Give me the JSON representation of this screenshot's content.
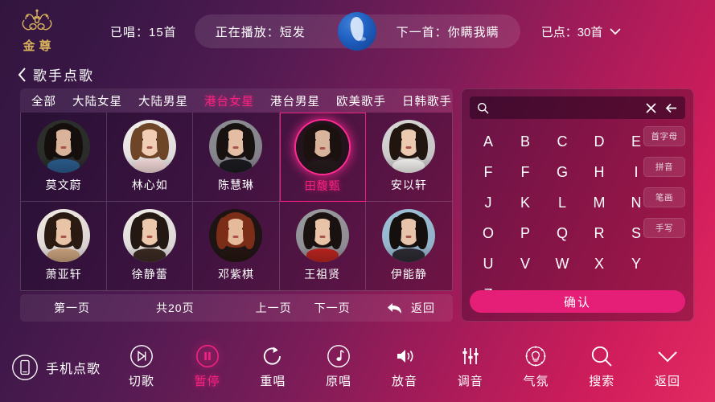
{
  "header": {
    "logo_text": "金尊",
    "logo_icon": "crown-icon",
    "sung_count": "已唱：15首",
    "now_playing": "正在播放：短发",
    "next_song": "下一首：你瞒我瞒",
    "globe_icon": "globe-icon",
    "ordered_count": "已点：30首",
    "ordered_chevron_icon": "chevron-down-icon"
  },
  "breadcrumb": {
    "back_icon": "chevron-left-icon",
    "title": "歌手点歌"
  },
  "tabs": [
    {
      "label": "全部",
      "active": false
    },
    {
      "label": "大陆女星",
      "active": false
    },
    {
      "label": "大陆男星",
      "active": false
    },
    {
      "label": "港台女星",
      "active": true
    },
    {
      "label": "港台男星",
      "active": false
    },
    {
      "label": "欧美歌手",
      "active": false
    },
    {
      "label": "日韩歌手",
      "active": false
    }
  ],
  "artists": [
    {
      "name": "莫文蔚",
      "selected": false,
      "bg": "#2b2f2a",
      "hair": "#140f0c",
      "skin": "#d9b39a",
      "top": "#2a5b8c"
    },
    {
      "name": "林心如",
      "selected": false,
      "bg": "#f3f1ee",
      "hair": "#6e4526",
      "skin": "#f0cdb4",
      "top": "#f2d7d7"
    },
    {
      "name": "陈慧琳",
      "selected": false,
      "bg": "#8d8d93",
      "hair": "#17120f",
      "skin": "#e3bda4",
      "top": "#1b1b20"
    },
    {
      "name": "田馥甄",
      "selected": true,
      "bg": "#23131b",
      "hair": "#1b1210",
      "skin": "#d8b49c",
      "top": "#241a1c"
    },
    {
      "name": "安以轩",
      "selected": false,
      "bg": "#d8d7d6",
      "hair": "#20160f",
      "skin": "#eccab0",
      "top": "#f2f0ee"
    },
    {
      "name": "萧亚轩",
      "selected": false,
      "bg": "#efe9e3",
      "hair": "#2a1a12",
      "skin": "#e9c3a6",
      "top": "#c9a27e"
    },
    {
      "name": "徐静蕾",
      "selected": false,
      "bg": "#efece8",
      "hair": "#241812",
      "skin": "#ecc8ad",
      "top": "#3a2a22"
    },
    {
      "name": "邓紫棋",
      "selected": false,
      "bg": "#1d1412",
      "hair": "#7c2d18",
      "skin": "#e5bb9c",
      "top": "#241612"
    },
    {
      "name": "王祖贤",
      "selected": false,
      "bg": "#9a9a9e",
      "hair": "#1a1210",
      "skin": "#e8c3a8",
      "top": "#b8241f"
    },
    {
      "name": "伊能静",
      "selected": false,
      "bg": "#9ec2d8",
      "hair": "#15100e",
      "skin": "#e8c4aa",
      "top": "#2d2b33"
    }
  ],
  "pager": {
    "first_page": "第一页",
    "total_pages": "共20页",
    "prev_page": "上一页",
    "next_page": "下一页",
    "return_icon": "return-arrow-icon",
    "return_label": "返回"
  },
  "search": {
    "icon": "search-icon",
    "value": "",
    "placeholder": "",
    "clear_icon": "close-x-icon",
    "backspace_icon": "backspace-arrow-icon"
  },
  "keyboard": {
    "rows": [
      [
        "A",
        "B",
        "C",
        "D",
        "E"
      ],
      [
        "F",
        "F",
        "G",
        "H",
        "I"
      ],
      [
        "J",
        "K",
        "L",
        "M",
        "N"
      ],
      [
        "O",
        "P",
        "Q",
        "R",
        "S"
      ],
      [
        "U",
        "V",
        "W",
        "X",
        "Y"
      ],
      [
        "Z"
      ]
    ],
    "modes": [
      "首字母",
      "拼音",
      "笔画",
      "手写"
    ],
    "confirm_label": "确认"
  },
  "bottom": {
    "phone_icon": "phone-order-icon",
    "phone_label": "手机点歌",
    "tools": [
      {
        "label": "切歌",
        "icon": "skip-next-icon",
        "active": false
      },
      {
        "label": "暂停",
        "icon": "pause-icon",
        "active": true
      },
      {
        "label": "重唱",
        "icon": "replay-icon",
        "active": false
      },
      {
        "label": "原唱",
        "icon": "music-note-icon",
        "active": false
      },
      {
        "label": "放音",
        "icon": "volume-icon",
        "active": false
      },
      {
        "label": "调音",
        "icon": "equalizer-icon",
        "active": false
      },
      {
        "label": "气氛",
        "icon": "light-bulb-icon",
        "active": false
      },
      {
        "label": "搜索",
        "icon": "search-icon",
        "active": false
      },
      {
        "label": "返回",
        "icon": "chevron-down-icon",
        "active": false
      }
    ]
  },
  "colors": {
    "accent_pink": "#f5227f",
    "confirm_pink": "#e51e78",
    "gold": "#d9b25c",
    "bg_purple": "#32153f",
    "bg_crimson": "#e22a62"
  }
}
